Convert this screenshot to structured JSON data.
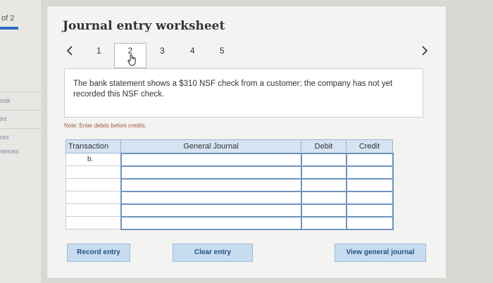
{
  "sidebar": {
    "page_indicator": "of 2",
    "links": [
      "ook",
      "int",
      "rint",
      "rences"
    ]
  },
  "worksheet": {
    "title": "Journal entry worksheet",
    "steps": [
      "1",
      "2",
      "3",
      "4",
      "5"
    ],
    "active_step": "2",
    "description": "The bank statement shows a $310 NSF check from a customer; the company has not yet recorded this NSF check.",
    "note": "Note: Enter debits before credits."
  },
  "table": {
    "headers": [
      "Transaction",
      "General Journal",
      "Debit",
      "Credit"
    ],
    "rows": [
      {
        "transaction": "b.",
        "account": "",
        "debit": "",
        "credit": ""
      },
      {
        "transaction": "",
        "account": "",
        "debit": "",
        "credit": ""
      },
      {
        "transaction": "",
        "account": "",
        "debit": "",
        "credit": ""
      },
      {
        "transaction": "",
        "account": "",
        "debit": "",
        "credit": ""
      },
      {
        "transaction": "",
        "account": "",
        "debit": "",
        "credit": ""
      },
      {
        "transaction": "",
        "account": "",
        "debit": "",
        "credit": ""
      }
    ]
  },
  "buttons": {
    "record": "Record entry",
    "clear": "Clear entry",
    "view": "View general journal"
  },
  "icons": {
    "prev": "chevron-left-icon",
    "next": "chevron-right-icon",
    "cursor": "hand-pointer-icon"
  },
  "colors": {
    "accent": "#2f6cc1",
    "header_bg": "#d6e3f2",
    "button_bg": "#c7dcf1",
    "note": "#a0543a"
  }
}
